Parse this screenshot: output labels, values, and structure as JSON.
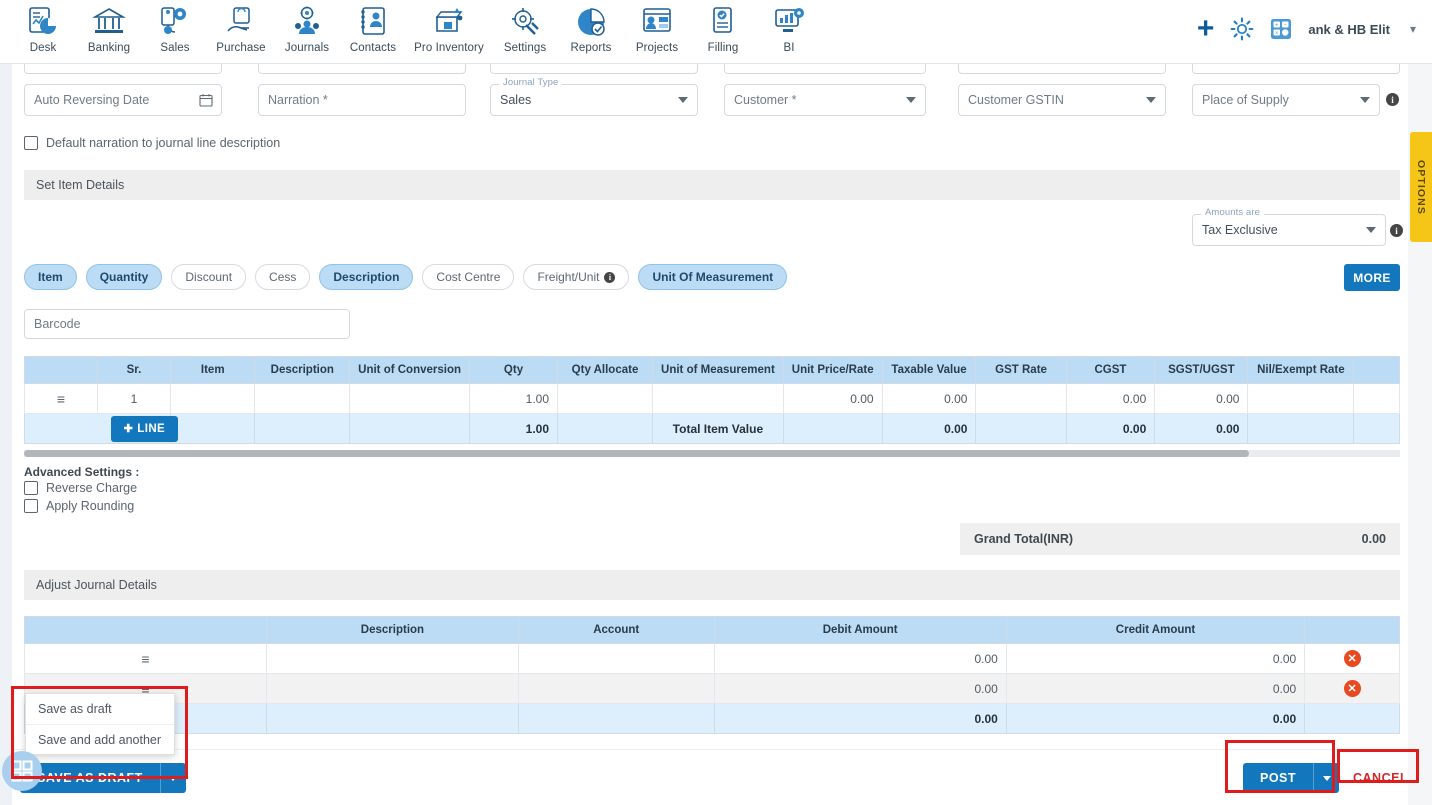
{
  "topnav": {
    "items": [
      {
        "label": "Desk",
        "icon": "desk-icon"
      },
      {
        "label": "Banking",
        "icon": "bank-icon"
      },
      {
        "label": "Sales",
        "icon": "sales-icon"
      },
      {
        "label": "Purchase",
        "icon": "purchase-icon"
      },
      {
        "label": "Journals",
        "icon": "journals-icon"
      },
      {
        "label": "Contacts",
        "icon": "contacts-icon"
      },
      {
        "label": "Pro Inventory",
        "icon": "inventory-icon"
      },
      {
        "label": "Settings",
        "icon": "settings-icon"
      },
      {
        "label": "Reports",
        "icon": "reports-icon"
      },
      {
        "label": "Projects",
        "icon": "projects-icon"
      },
      {
        "label": "Filling",
        "icon": "filling-icon"
      },
      {
        "label": "BI",
        "icon": "bi-icon"
      }
    ],
    "add_icon": "plus-icon",
    "settings_icon": "gear-icon",
    "calculator_icon": "calculator-icon",
    "org_name": "ank & HB Elit",
    "org_chevron": "chevron-down-icon"
  },
  "form": {
    "auto_reversing_date": {
      "placeholder": "Auto Reversing Date",
      "value": "",
      "icon": "calendar-icon"
    },
    "narration": {
      "placeholder": "Narration *",
      "value": ""
    },
    "journal_type": {
      "label": "Journal Type",
      "value": "Sales"
    },
    "customer": {
      "placeholder": "Customer *",
      "value": ""
    },
    "customer_gstin": {
      "placeholder": "Customer GSTIN",
      "value": ""
    },
    "place_of_supply": {
      "placeholder": "Place of Supply",
      "value": ""
    },
    "default_narration_label": "Default narration to journal line description"
  },
  "options_tab": {
    "label": "OPTIONS"
  },
  "set_item_details": {
    "title": "Set Item Details"
  },
  "amounts_are": {
    "label": "Amounts are",
    "value": "Tax Exclusive"
  },
  "chips": [
    {
      "label": "Item",
      "selected": true
    },
    {
      "label": "Quantity",
      "selected": true
    },
    {
      "label": "Discount",
      "selected": false
    },
    {
      "label": "Cess",
      "selected": false
    },
    {
      "label": "Description",
      "selected": true
    },
    {
      "label": "Cost Centre",
      "selected": false
    },
    {
      "label": "Freight/Unit",
      "selected": false,
      "info": true
    },
    {
      "label": "Unit Of Measurement",
      "selected": true
    }
  ],
  "more_button": {
    "label": "MORE"
  },
  "barcode": {
    "placeholder": "Barcode",
    "value": ""
  },
  "item_table": {
    "columns": [
      "",
      "Sr.",
      "Item",
      "Description",
      "Unit of Conversion",
      "Qty",
      "Qty Allocate",
      "Unit of Measurement",
      "Unit Price/Rate",
      "Taxable Value",
      "GST Rate",
      "CGST",
      "SGST/UGST",
      "Nil/Exempt Rate",
      ""
    ],
    "rows": [
      {
        "handle": "≡",
        "sr": "1",
        "item": "",
        "description": "",
        "unit_of_conversion": "",
        "qty": "1.00",
        "qty_allocate": "",
        "unit_of_measurement": "",
        "unit_price": "0.00",
        "taxable_value": "0.00",
        "gst_rate": "",
        "cgst": "0.00",
        "sgst_ugst": "0.00",
        "nil_exempt_rate": ""
      }
    ],
    "footer": {
      "add_line_label": "LINE",
      "qty_total": "1.00",
      "total_label": "Total Item Value",
      "taxable_total": "0.00",
      "cgst_total": "0.00",
      "sgst_total": "0.00"
    }
  },
  "advanced_settings": {
    "title": "Advanced Settings :",
    "options": [
      {
        "label": "Reverse Charge",
        "checked": false
      },
      {
        "label": "Apply Rounding",
        "checked": false
      }
    ]
  },
  "grand_total": {
    "label": "Grand Total(INR)",
    "value": "0.00"
  },
  "adjust_journal": {
    "title": "Adjust Journal Details",
    "columns": [
      "",
      "Description",
      "Account",
      "Debit Amount",
      "Credit Amount",
      ""
    ],
    "rows": [
      {
        "handle": "≡",
        "description": "",
        "account": "",
        "debit": "0.00",
        "credit": "0.00",
        "delete_icon": "delete-circle-icon"
      },
      {
        "handle": "≡",
        "description": "",
        "account": "",
        "debit": "0.00",
        "credit": "0.00",
        "delete_icon": "delete-circle-icon"
      }
    ],
    "totals": {
      "debit": "0.00",
      "credit": "0.00"
    }
  },
  "save_dropdown": {
    "items": [
      "Save as draft",
      "Save and add another"
    ]
  },
  "footer_buttons": {
    "save_as_draft": "SAVE AS DRAFT",
    "post": "POST",
    "cancel": "CANCEL",
    "widget_icon": "widget-grid-icon"
  },
  "colors": {
    "accent_blue": "#1277bc",
    "header_blue": "#bcdcf6",
    "highlight_red": "#e01b1b",
    "options_yellow": "#f5c518",
    "delete_orange": "#e8491f"
  }
}
